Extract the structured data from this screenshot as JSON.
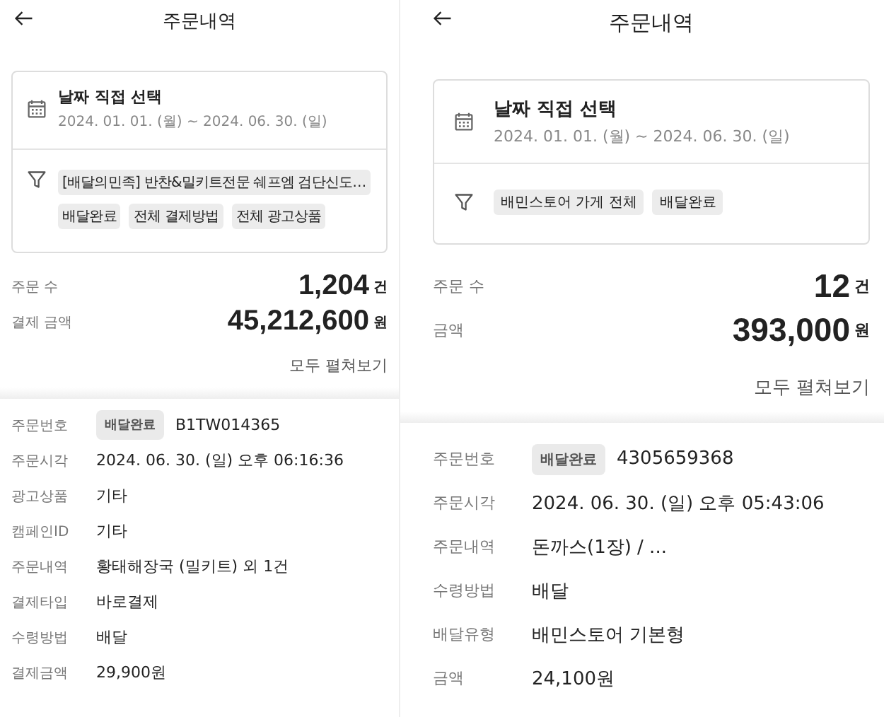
{
  "screens": [
    {
      "title": "주문내역",
      "date_filter": {
        "label": "날짜 직접 선택",
        "range": "2024. 01. 01. (월) ~ 2024. 06. 30. (일)"
      },
      "filter_chips": [
        "[배달의민족] 반찬&밀키트전문 쉐프엠 검단신도…",
        "배달완료",
        "전체 결제방법",
        "전체 광고상품"
      ],
      "summary": [
        {
          "label": "주문 수",
          "value": "1,204",
          "unit": "건"
        },
        {
          "label": "결제 금액",
          "value": "45,212,600",
          "unit": "원"
        }
      ],
      "expand_all": "모두 펼쳐보기",
      "order": {
        "badge": "배달완료",
        "fields": [
          {
            "label": "주문번호",
            "value": "B1TW014365"
          },
          {
            "label": "주문시각",
            "value": "2024. 06. 30. (일) 오후 06:16:36"
          },
          {
            "label": "광고상품",
            "value": "기타"
          },
          {
            "label": "캠페인ID",
            "value": "기타"
          },
          {
            "label": "주문내역",
            "value": "황태해장국 (밀키트) 외 1건"
          },
          {
            "label": "결제타입",
            "value": "바로결제"
          },
          {
            "label": "수령방법",
            "value": "배달"
          },
          {
            "label": "결제금액",
            "value": "29,900원"
          }
        ]
      }
    },
    {
      "title": "주문내역",
      "date_filter": {
        "label": "날짜 직접 선택",
        "range": "2024. 01. 01. (월) ~ 2024. 06. 30. (일)"
      },
      "filter_chips": [
        "배민스토어 가게 전체",
        "배달완료"
      ],
      "summary": [
        {
          "label": "주문 수",
          "value": "12",
          "unit": "건"
        },
        {
          "label": "금액",
          "value": "393,000",
          "unit": "원"
        }
      ],
      "expand_all": "모두 펼쳐보기",
      "order": {
        "badge": "배달완료",
        "fields": [
          {
            "label": "주문번호",
            "value": "4305659368"
          },
          {
            "label": "주문시각",
            "value": "2024. 06. 30. (일) 오후 05:43:06"
          },
          {
            "label": "주문내역",
            "value": "돈까스(1장) / ..."
          },
          {
            "label": "수령방법",
            "value": "배달"
          },
          {
            "label": "배달유형",
            "value": "배민스토어 기본형"
          },
          {
            "label": "금액",
            "value": "24,100원"
          }
        ]
      }
    }
  ]
}
